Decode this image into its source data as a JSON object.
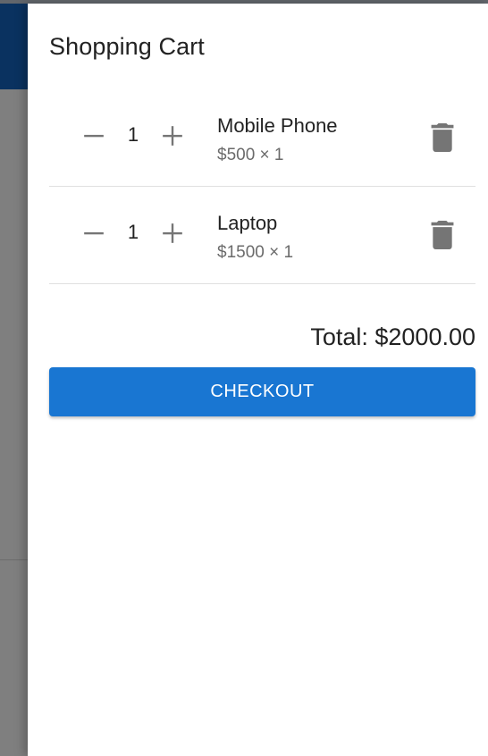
{
  "cart": {
    "title": "Shopping Cart",
    "items": [
      {
        "name": "Mobile Phone",
        "quantity": "1",
        "price_line": "$500 × 1",
        "decrease_icon": "minus-icon",
        "increase_icon": "plus-icon",
        "delete_icon": "trash-icon"
      },
      {
        "name": "Laptop",
        "quantity": "1",
        "price_line": "$1500 × 1",
        "decrease_icon": "minus-icon",
        "increase_icon": "plus-icon",
        "delete_icon": "trash-icon"
      }
    ],
    "total": "Total: $2000.00",
    "checkout_label": "CHECKOUT"
  },
  "colors": {
    "app_bar": "#1565c0",
    "checkout_button": "#1976d2",
    "icon_gray": "#757575"
  }
}
